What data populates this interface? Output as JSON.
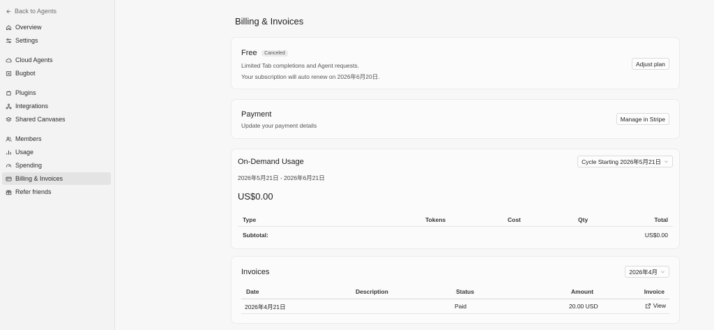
{
  "sidebar": {
    "back_label": "Back to Agents",
    "items": [
      {
        "label": "Overview",
        "icon": "home-icon"
      },
      {
        "label": "Settings",
        "icon": "sliders-icon"
      },
      {
        "label": "Cloud Agents",
        "icon": "cloud-icon"
      },
      {
        "label": "Bugbot",
        "icon": "bug-icon"
      },
      {
        "label": "Plugins",
        "icon": "plugin-icon"
      },
      {
        "label": "Integrations",
        "icon": "integrations-icon"
      },
      {
        "label": "Shared Canvases",
        "icon": "canvas-icon"
      },
      {
        "label": "Members",
        "icon": "members-icon"
      },
      {
        "label": "Usage",
        "icon": "bar-chart-icon"
      },
      {
        "label": "Spending",
        "icon": "gauge-icon"
      },
      {
        "label": "Billing & Invoices",
        "icon": "credit-card-icon",
        "active": true
      },
      {
        "label": "Refer friends",
        "icon": "gift-icon"
      }
    ]
  },
  "page": {
    "title": "Billing & Invoices"
  },
  "plan": {
    "name": "Free",
    "badge": "Canceled",
    "line1": "Limited Tab completions and Agent requests.",
    "line2": "Your subscription will auto renew on 2026年6月20日.",
    "button": "Adjust plan"
  },
  "payment": {
    "title": "Payment",
    "subtitle": "Update your payment details",
    "button": "Manage in Stripe"
  },
  "usage": {
    "title": "On-Demand Usage",
    "cycle_select": "Cycle Starting 2026年5月21日",
    "date_range": "2026年5月21日 - 2026年6月21日",
    "amount": "US$0.00",
    "columns": {
      "type": "Type",
      "tokens": "Tokens",
      "cost": "Cost",
      "qty": "Qty",
      "total": "Total"
    },
    "subtotal_label": "Subtotal:",
    "subtotal_value": "US$0.00"
  },
  "invoices": {
    "title": "Invoices",
    "month_select": "2026年4月",
    "columns": {
      "date": "Date",
      "description": "Description",
      "status": "Status",
      "amount": "Amount",
      "invoice": "Invoice"
    },
    "rows": [
      {
        "date": "2026年4月21日",
        "description": "",
        "status": "Paid",
        "amount": "20.00 USD",
        "invoice": "View"
      }
    ]
  }
}
